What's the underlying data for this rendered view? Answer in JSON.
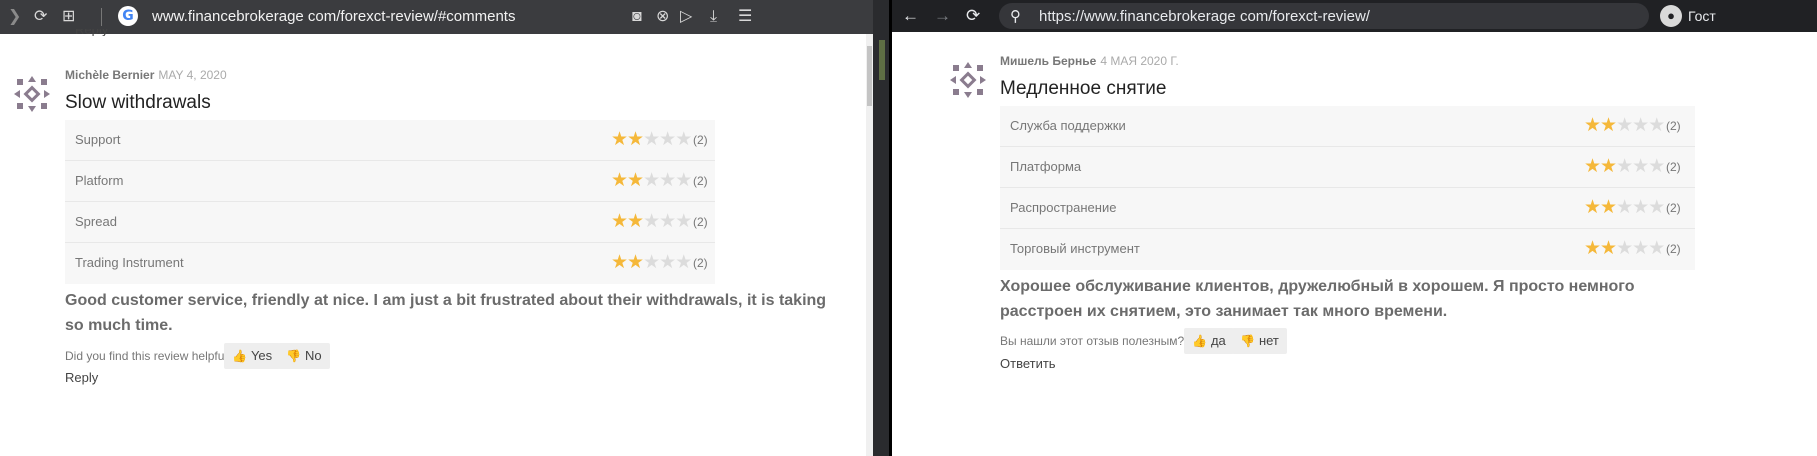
{
  "left_browser": {
    "url": "www.financebrokerage com/forexct-review/#comments",
    "icons": [
      "forward-icon",
      "reload-icon",
      "tab-grid-icon",
      "google-icon",
      "camera-icon",
      "shield-icon",
      "send-icon",
      "download-icon",
      "menu-icon"
    ],
    "g_letter": "G"
  },
  "right_browser": {
    "url": "https://www.financebrokerage com/forexct-review/",
    "profile_name": "Гост",
    "icons": [
      "back-icon",
      "forward-icon",
      "reload-icon",
      "search-icon",
      "profile-icon"
    ]
  },
  "left_review": {
    "prev_reply": "Reply",
    "author": "Michèle Bernier",
    "date": "MAY 4, 2020",
    "title": "Slow withdrawals",
    "ratings": [
      {
        "label": "Support",
        "stars": 2,
        "count": "(2)"
      },
      {
        "label": "Platform",
        "stars": 2,
        "count": "(2)"
      },
      {
        "label": "Spread",
        "stars": 2,
        "count": "(2)"
      },
      {
        "label": "Trading Instrument",
        "stars": 2,
        "count": "(2)"
      }
    ],
    "body": "Good customer service, friendly at nice. I am just a bit frustrated about their withdrawals, it is taking so much time.",
    "helpful_question": "Did you find this review helpful?",
    "yes_label": "Yes",
    "no_label": "No",
    "reply_label": "Reply"
  },
  "right_review": {
    "author": "Мишель Бернье",
    "date": "4 МАЯ 2020 Г.",
    "title": "Медленное снятие",
    "ratings": [
      {
        "label": "Служба поддержки",
        "stars": 2,
        "count": "(2)"
      },
      {
        "label": "Платформа",
        "stars": 2,
        "count": "(2)"
      },
      {
        "label": "Распространение",
        "stars": 2,
        "count": "(2)"
      },
      {
        "label": "Торговый инструмент",
        "stars": 2,
        "count": "(2)"
      }
    ],
    "body": "Хорошее обслуживание клиентов, дружелюбный в хорошем. Я просто немного расстроен их снятием, это занимает так много времени.",
    "helpful_question": "Вы нашли этот отзыв полезным?",
    "yes_label": "да",
    "no_label": "нет",
    "reply_label": "Ответить"
  },
  "colors": {
    "star_filled": "#f5b83a",
    "star_empty": "#dcdcdc",
    "avatar": "#8a7c8e"
  }
}
